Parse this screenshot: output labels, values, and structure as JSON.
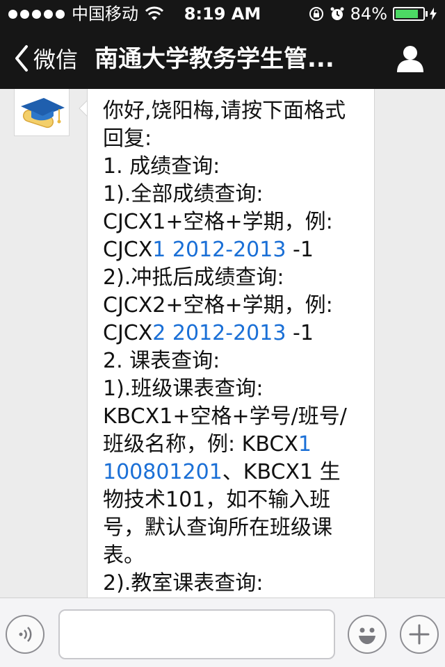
{
  "status_bar": {
    "carrier": "中国移动",
    "time": "8:19 AM",
    "battery": "84%",
    "battery_level": 0.84,
    "icons": [
      "signal-dots-icon",
      "wifi-icon",
      "rotation-lock-icon",
      "alarm-icon",
      "battery-icon",
      "charging-bolt-icon"
    ]
  },
  "nav": {
    "back_label": "微信",
    "title": "南通大学教务学生管...",
    "back_icon": "chevron-left-icon",
    "profile_icon": "person-icon"
  },
  "message": {
    "avatar_icon": "graduation-cap-icon",
    "lines": [
      [
        {
          "t": "你好,饶阳梅,请按下面格式"
        }
      ],
      [
        {
          "t": "回复:"
        }
      ],
      [
        {
          "t": "1. 成绩查询:"
        }
      ],
      [
        {
          "t": "1).全部成绩查询:"
        }
      ],
      [
        {
          "t": "CJCX1+空格+学期，例:"
        }
      ],
      [
        {
          "t": "CJCX"
        },
        {
          "t": "1 2012-2013",
          "link": true
        },
        {
          "t": " -1"
        }
      ],
      [
        {
          "t": "2).冲抵后成绩查询:"
        }
      ],
      [
        {
          "t": "CJCX2+空格+学期，例:"
        }
      ],
      [
        {
          "t": "CJCX"
        },
        {
          "t": "2 2012-2013",
          "link": true
        },
        {
          "t": " -1"
        }
      ],
      [
        {
          "t": "2. 课表查询:"
        }
      ],
      [
        {
          "t": "1).班级课表查询:"
        }
      ],
      [
        {
          "t": "KBCX1+空格+学号/班号/"
        }
      ],
      [
        {
          "t": "班级名称，例: KBCX"
        },
        {
          "t": "1",
          "link": true
        }
      ],
      [
        {
          "t": "100801201",
          "link": true
        },
        {
          "t": "、KBCX1 生"
        }
      ],
      [
        {
          "t": "物技术101，如不输入班"
        }
      ],
      [
        {
          "t": "号，默认查询所在班级课"
        }
      ],
      [
        {
          "t": "表。"
        }
      ],
      [
        {
          "t": "2).教室课表查询:"
        }
      ]
    ]
  },
  "input_bar": {
    "voice_icon": "voice-icon",
    "emoji_icon": "emoji-icon",
    "plus_icon": "plus-icon",
    "text_value": ""
  },
  "colors": {
    "header_bg": "#161616",
    "link": "#1a6fd6",
    "battery_fill": "#4cd964",
    "chat_bg": "#ececec"
  }
}
